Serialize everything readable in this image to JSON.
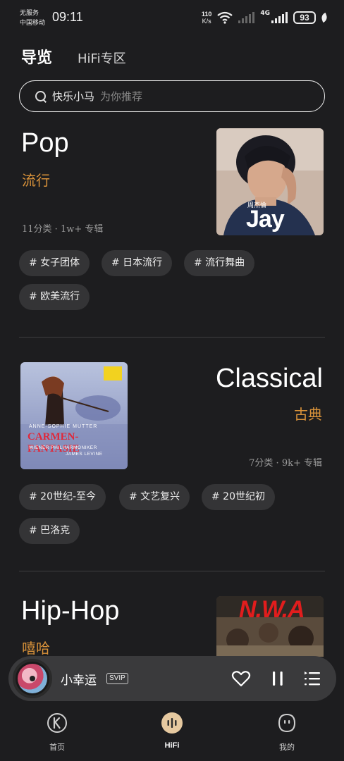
{
  "status_bar": {
    "carrier_line1": "无服务",
    "carrier_line2": "中国移动",
    "time": "09:11",
    "net_speed_value": "110",
    "net_speed_unit": "K/s",
    "network_type": "4G",
    "battery": "93"
  },
  "top_tabs": {
    "active": "导览",
    "inactive": "HiFi专区"
  },
  "search": {
    "text": "快乐小马",
    "hint": "为你推荐"
  },
  "genres": [
    {
      "title": "Pop",
      "subtitle": "流行",
      "meta": "11分类 · 1w+ 专辑",
      "cover_text": "Jay",
      "cover_small_text": "周杰倫",
      "tags": [
        "# 女子团体",
        "# 日本流行",
        "# 流行舞曲",
        "# 欧美流行"
      ]
    },
    {
      "title": "Classical",
      "subtitle": "古典",
      "meta": "7分类 · 9k+ 专辑",
      "cover_line1": "ANNE-SOPHIE MUTTER",
      "cover_line2": "CARMEN-FANTASIE",
      "cover_line3": "WIENER PHILHARMONIKER",
      "cover_line4": "JAMES LEVINE",
      "tags": [
        "# 20世纪-至今",
        "# 文艺复兴",
        "# 20世纪初",
        "# 巴洛克"
      ]
    },
    {
      "title": "Hip-Hop",
      "subtitle": "嘻哈",
      "cover_text": "N.W.A"
    }
  ],
  "player": {
    "song": "小幸运",
    "badge": "SVIP"
  },
  "bottom_nav": {
    "items": [
      {
        "label": "首页"
      },
      {
        "label": "HiFi"
      },
      {
        "label": "我的"
      }
    ]
  },
  "colors": {
    "background": "#1d1d1f",
    "accent_orange": "#d9923a",
    "chip_bg": "#343436",
    "player_bg": "#3a3a3c"
  }
}
